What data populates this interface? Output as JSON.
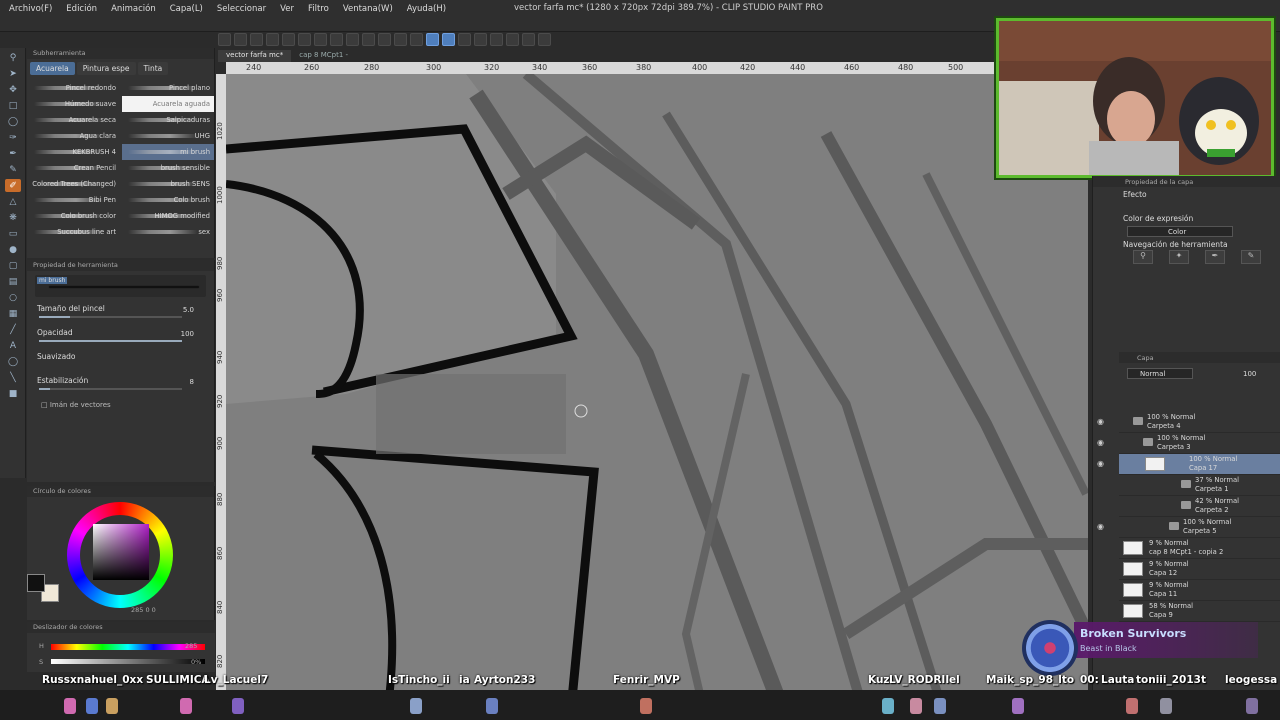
{
  "menu": [
    "Archivo(F)",
    "Edición",
    "Animación",
    "Capa(L)",
    "Seleccionar",
    "Ver",
    "Filtro",
    "Ventana(W)",
    "Ayuda(H)"
  ],
  "window_title": "vector farfa mc* (1280 x 720px 72dpi 389.7%) - CLIP STUDIO PAINT PRO",
  "doc_tabs": [
    "vector farfa mc*",
    "cap 8 MCpt1 -"
  ],
  "subtool": {
    "panel_title": "Subherramienta",
    "tabs": [
      "Acuarela",
      "Pintura espe",
      "Tinta"
    ],
    "brushes": [
      [
        "Pincel redondo",
        "Pincel plano"
      ],
      [
        "Húmedo suave",
        "Acuarela aguada"
      ],
      [
        "Acuarela seca",
        "Salpicaduras"
      ],
      [
        "Agua clara",
        "UHG"
      ],
      [
        "KEKBRUSH 4",
        "mi brush"
      ],
      [
        "Crean Pencil",
        "brush sensible"
      ],
      [
        "Colored Trees (Changed)",
        "brush SENS"
      ],
      [
        "Bibi Pen",
        "Colo brush"
      ],
      [
        "Colo brush color",
        "HIMOG modified"
      ],
      [
        "Succubus line art",
        "sex"
      ]
    ]
  },
  "tool_property": {
    "panel_title": "Propiedad de herramienta",
    "brush_name": "mi brush",
    "size_label": "Tamaño del pincel",
    "size_value": "5.0",
    "opacity_label": "Opacidad",
    "opacity_value": "100",
    "smooth_label": "Suavizado",
    "stab_label": "Estabilización",
    "stab_value": "8",
    "vector_label": "Imán de vectores"
  },
  "color_wheel": {
    "panel_title": "Círculo de colores",
    "readout": "285 0 0"
  },
  "color_slider": {
    "panel_title": "Deslizador de colores",
    "h_label": "H",
    "h_value": "285",
    "s_label": "S",
    "s_value": "0%"
  },
  "ruler_top": [
    "240",
    "260",
    "280",
    "300",
    "320",
    "340",
    "360",
    "380",
    "400",
    "420",
    "440",
    "460",
    "480",
    "500"
  ],
  "ruler_left": [
    "1020",
    "1000",
    "980",
    "960",
    "940",
    "920",
    "900",
    "880",
    "860",
    "840",
    "820"
  ],
  "right": {
    "layer_prop_title": "Propiedad de la capa",
    "effect_label": "Efecto",
    "expr_color_label": "Color de expresión",
    "expr_color_value": "Color",
    "nav_label": "Navegación de herramienta",
    "layer_title": "Capa",
    "blend_mode": "Normal",
    "opacity": "100"
  },
  "layers": [
    {
      "t1": "100 % Normal",
      "t2": "Carpeta 4",
      "type": "folder",
      "indent": 14
    },
    {
      "t1": "100 % Normal",
      "t2": "Carpeta 3",
      "type": "folder",
      "indent": 24
    },
    {
      "t1": "100 % Normal",
      "t2": "Capa 17",
      "type": "layer",
      "indent": 34,
      "selected": true
    },
    {
      "t1": "37 % Normal",
      "t2": "Carpeta 1",
      "type": "folder",
      "indent": 34
    },
    {
      "t1": "42 % Normal",
      "t2": "Carpeta 2",
      "type": "folder",
      "indent": 34
    },
    {
      "t1": "100 % Normal",
      "t2": "Carpeta 5",
      "type": "folder",
      "indent": 24
    },
    {
      "t1": "9 % Normal",
      "t2": "cap 8 MCpt1 - copia 2",
      "type": "layer",
      "indent": 0
    },
    {
      "t1": "9 % Normal",
      "t2": "Capa 12",
      "type": "layer",
      "indent": 0
    },
    {
      "t1": "9 % Normal",
      "t2": "Capa 11",
      "type": "layer",
      "indent": 0
    },
    {
      "t1": "58 % Normal",
      "t2": "Capa 9",
      "type": "layer",
      "indent": 0
    }
  ],
  "now_playing": {
    "song": "Broken Survivors",
    "artist": "Beast in Black"
  },
  "chat_names": [
    "Russ",
    "xnahuel_0xx",
    "SULLIMICA",
    "Lv_Lacuel7",
    "IsTincho_ii",
    "ia",
    "Ayrton233",
    "Fenrir_MVP",
    "Kuz",
    "LV_RODRII",
    "el",
    "Maik_sp_98_lto",
    "00:",
    "Lauta",
    "toniii_2013t",
    "leogessa a"
  ],
  "colors": {
    "accent": "#4f7fbd",
    "webcam_border": "#5dbb2e",
    "tool_selected": "#c86c2a"
  }
}
